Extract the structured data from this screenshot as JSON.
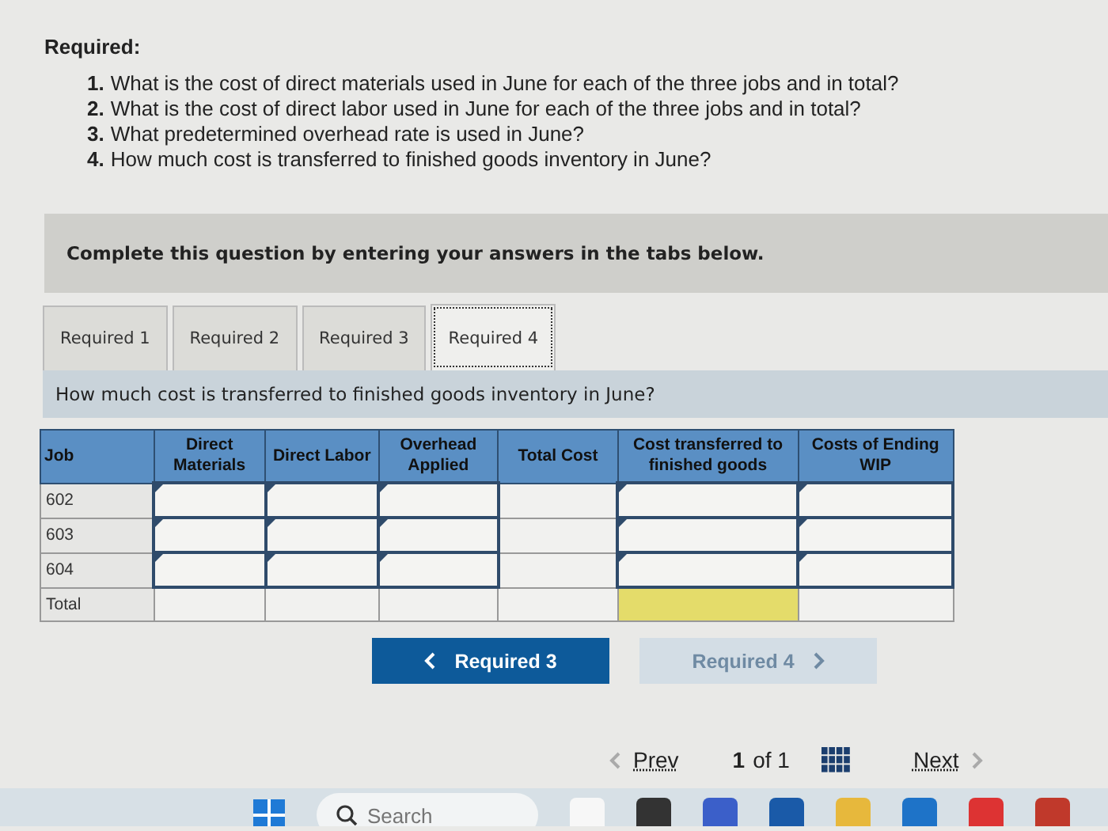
{
  "heading": "Required:",
  "questions": [
    {
      "number": "1.",
      "text": "What is the cost of direct materials used in June for each of the three jobs and in total?"
    },
    {
      "number": "2.",
      "text": "What is the cost of direct labor used in June for each of the three jobs and in total?"
    },
    {
      "number": "3.",
      "text": "What predetermined overhead rate is used in June?"
    },
    {
      "number": "4.",
      "text": "How much cost is transferred to finished goods inventory in June?"
    }
  ],
  "instruction": "Complete this question by entering your answers in the tabs below.",
  "tabs": [
    {
      "label": "Required 1",
      "selected": false
    },
    {
      "label": "Required 2",
      "selected": false
    },
    {
      "label": "Required 3",
      "selected": false
    },
    {
      "label": "Required 4",
      "selected": true
    }
  ],
  "prompt": "How much cost is transferred to finished goods inventory in June?",
  "table": {
    "columns": [
      "Job",
      "Direct Materials",
      "Direct Labor",
      "Overhead Applied",
      "Total Cost",
      "Cost transferred to finished goods",
      "Costs of Ending WIP"
    ],
    "rows": [
      {
        "job": "602",
        "cells": [
          {
            "kind": "input"
          },
          {
            "kind": "input"
          },
          {
            "kind": "input"
          },
          {
            "kind": "plain"
          },
          {
            "kind": "input"
          },
          {
            "kind": "input"
          }
        ]
      },
      {
        "job": "603",
        "cells": [
          {
            "kind": "input"
          },
          {
            "kind": "input"
          },
          {
            "kind": "input"
          },
          {
            "kind": "plain"
          },
          {
            "kind": "input"
          },
          {
            "kind": "input"
          }
        ]
      },
      {
        "job": "604",
        "cells": [
          {
            "kind": "input"
          },
          {
            "kind": "input"
          },
          {
            "kind": "input"
          },
          {
            "kind": "plain"
          },
          {
            "kind": "input"
          },
          {
            "kind": "input"
          }
        ]
      },
      {
        "job": "Total",
        "cells": [
          {
            "kind": "plain"
          },
          {
            "kind": "plain"
          },
          {
            "kind": "plain"
          },
          {
            "kind": "plain"
          },
          {
            "kind": "highlight"
          },
          {
            "kind": "plain"
          }
        ]
      }
    ]
  },
  "nav_buttons": [
    {
      "label": "Required 3",
      "kind": "prev",
      "disabled": false
    },
    {
      "label": "Required 4",
      "kind": "next",
      "disabled": true
    }
  ],
  "pager": {
    "prev": "Prev",
    "current": "1",
    "of": "of 1",
    "next": "Next"
  },
  "taskbar": {
    "search_placeholder": "Search"
  }
}
